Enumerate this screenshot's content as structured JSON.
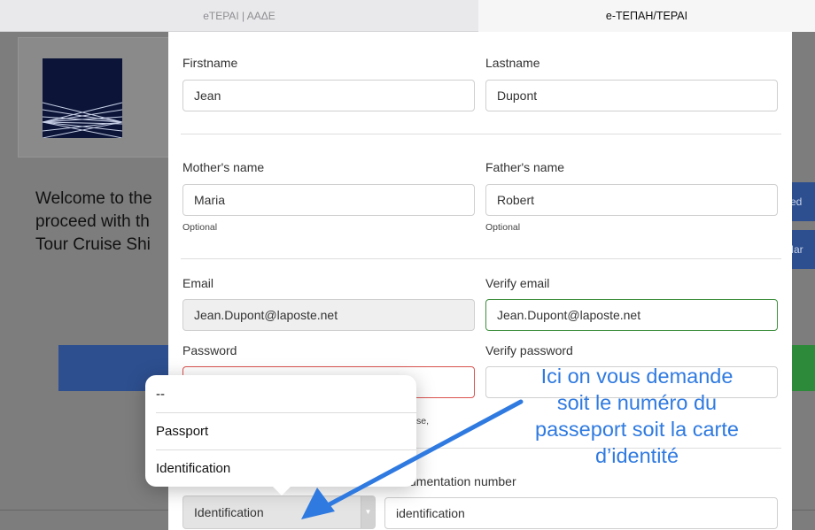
{
  "tabs": {
    "left_title": "eTEPAI | AAΔE",
    "right_title": "e-TEΠAH/TEPAI",
    "close_glyph": "✕"
  },
  "background": {
    "welcome_lines": [
      "Welcome to the",
      "proceed with th",
      "Tour Cruise Shi"
    ],
    "right_button_1": "ked",
    "right_button_2": "Mar"
  },
  "form": {
    "firstname_label": "Firstname",
    "firstname_value": "Jean",
    "lastname_label": "Lastname",
    "lastname_value": "Dupont",
    "mothers_name_label": "Mother's name",
    "mothers_name_value": "Maria",
    "mothers_name_help": "Optional",
    "fathers_name_label": "Father's name",
    "fathers_name_value": "Robert",
    "fathers_name_help": "Optional",
    "email_label": "Email",
    "email_value": "Jean.Dupont@laposte.net",
    "verify_email_label": "Verify email",
    "verify_email_value": "Jean.Dupont@laposte.net",
    "password_label": "Password",
    "verify_password_label": "Verify password",
    "password_help_fragment": "se,",
    "doc_number_label_fragment": "umentation number",
    "doc_type_selected": "Identification",
    "doc_number_value": "identification"
  },
  "dropdown": {
    "options": [
      "--",
      "Passport",
      "Identification"
    ]
  },
  "annotation": {
    "lines": [
      "Ici on vous demande",
      "soit le numéro du",
      "passeport soit la carte",
      "d’identité"
    ],
    "color": "#2f7ae0"
  },
  "colors": {
    "valid_border": "#3e8f3e",
    "invalid_border": "#d9534f",
    "dim_overlay": "#7d7d7d"
  }
}
